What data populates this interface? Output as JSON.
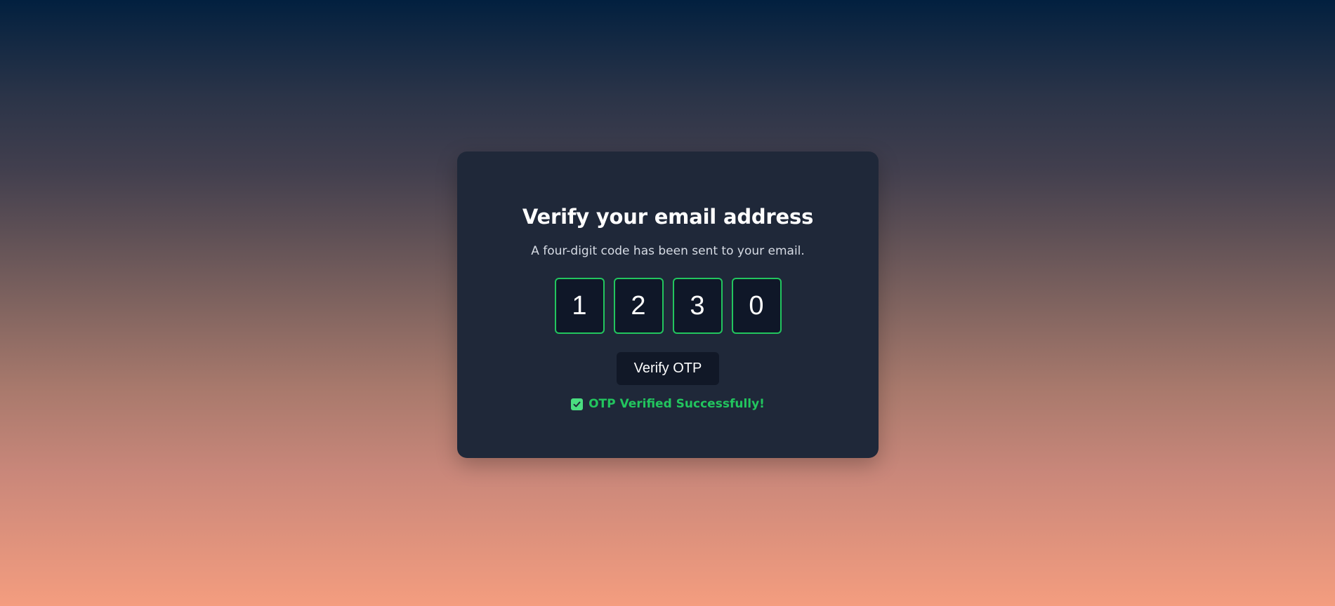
{
  "card": {
    "title": "Verify your email address",
    "subtitle": "A four-digit code has been sent to your email.",
    "otp_digits": [
      "1",
      "2",
      "3",
      "0"
    ],
    "verify_button_label": "Verify OTP",
    "status_icon": "checkbox-checked-icon",
    "status_text": "OTP Verified Successfully!"
  },
  "colors": {
    "card_background": "#1f2839",
    "accent_success": "#22c55e",
    "button_background": "#111827",
    "gradient_top": "#02203f",
    "gradient_bottom": "#f49d7f"
  }
}
